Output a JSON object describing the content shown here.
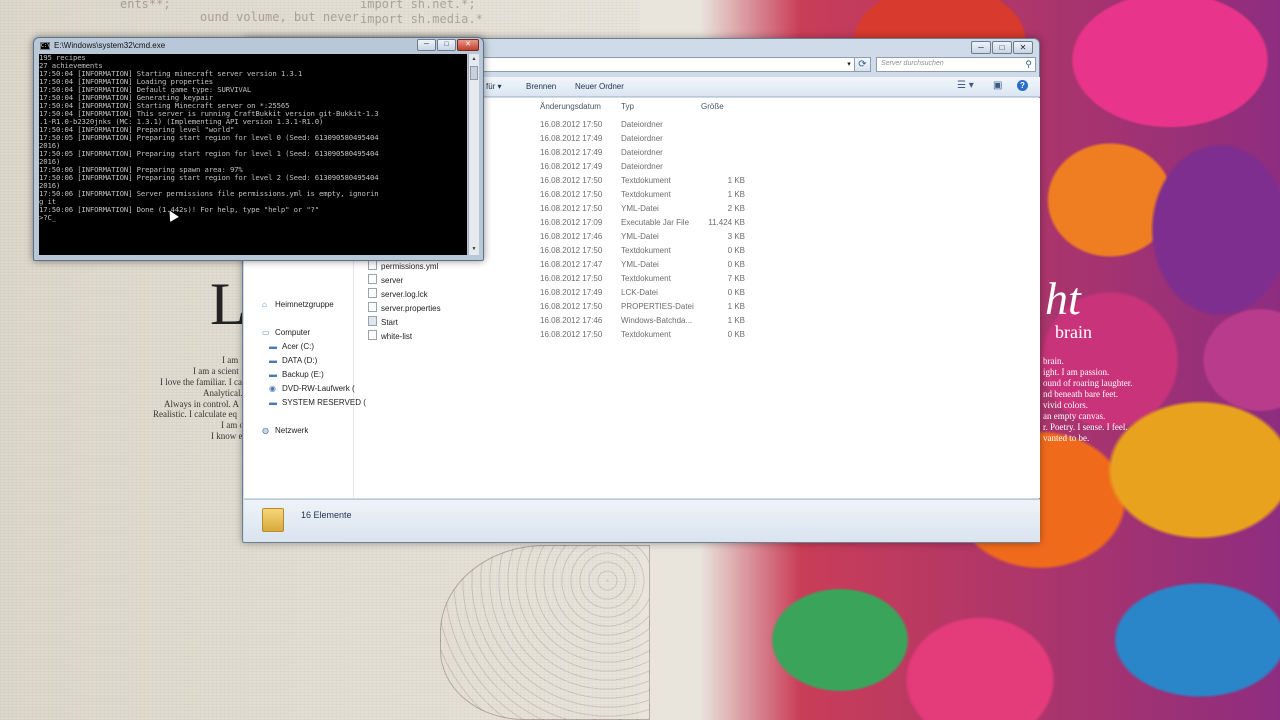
{
  "cmd": {
    "title": "E:\\Windows\\system32\\cmd.exe",
    "lines": [
      "195 recipes",
      "27 achievements",
      "17:50:04 [INFORMATION] Starting minecraft server version 1.3.1",
      "17:50:04 [INFORMATION] Loading properties",
      "17:50:04 [INFORMATION] Default game type: SURVIVAL",
      "17:50:04 [INFORMATION] Generating keypair",
      "17:50:04 [INFORMATION] Starting Minecraft server on *:25565",
      "17:50:04 [INFORMATION] This server is running CraftBukkit version git-Bukkit-1.3",
      ".1-R1.0-b2320jnks (MC: 1.3.1) (Implementing API version 1.3.1-R1.0)",
      "17:50:04 [INFORMATION] Preparing level \"world\"",
      "17:50:05 [INFORMATION] Preparing start region for level 0 (Seed: 613090580495404",
      "2016)",
      "17:50:05 [INFORMATION] Preparing start region for level 1 (Seed: 613090580495404",
      "2016)",
      "17:50:06 [INFORMATION] Preparing spawn area: 97%",
      "17:50:06 [INFORMATION] Preparing start region for level 2 (Seed: 613090580495404",
      "2016)",
      "17:50:06 [INFORMATION] Server permissions file permissions.yml is empty, ignorin",
      "g it",
      "17:50:06 [INFORMATION] Done (1.442s)! For help, type \"help\" or \"?\"",
      ">?C_"
    ]
  },
  "explorer": {
    "caption": {
      "minimize": "─",
      "maximize": "□",
      "close": "✕"
    },
    "search_placeholder": "Server durchsuchen",
    "toolbar": {
      "share_label": "für ▾",
      "burn_label": "Brennen",
      "new_folder_label": "Neuer Ordner"
    },
    "columns": {
      "date": "Änderungsdatum",
      "type": "Typ",
      "size": "Größe"
    },
    "nav": [
      {
        "label": "Heimnetzgruppe",
        "icon": "homegroup-icon",
        "indent": 0
      },
      {
        "label": "Computer",
        "icon": "computer-icon",
        "indent": 0
      },
      {
        "label": "Acer (C:)",
        "icon": "drive-icon",
        "indent": 1
      },
      {
        "label": "DATA (D:)",
        "icon": "drive-icon",
        "indent": 1
      },
      {
        "label": "Backup (E:)",
        "icon": "drive-icon",
        "indent": 1
      },
      {
        "label": "DVD-RW-Laufwerk (",
        "icon": "dvd-drive-icon",
        "indent": 1
      },
      {
        "label": "SYSTEM RESERVED (",
        "icon": "drive-icon",
        "indent": 1
      },
      {
        "label": "Netzwerk",
        "icon": "network-icon",
        "indent": 0
      }
    ],
    "files": [
      {
        "name": "",
        "date": "16.08.2012 17:50",
        "type": "Dateiordner",
        "size": ""
      },
      {
        "name": "",
        "date": "16.08.2012 17:49",
        "type": "Dateiordner",
        "size": ""
      },
      {
        "name": "",
        "date": "16.08.2012 17:49",
        "type": "Dateiordner",
        "size": ""
      },
      {
        "name": "",
        "date": "16.08.2012 17:49",
        "type": "Dateiordner",
        "size": ""
      },
      {
        "name": "",
        "date": "16.08.2012 17:50",
        "type": "Textdokument",
        "size": "1 KB"
      },
      {
        "name": "",
        "date": "16.08.2012 17:50",
        "type": "Textdokument",
        "size": "1 KB"
      },
      {
        "name": "",
        "date": "16.08.2012 17:50",
        "type": "YML-Datei",
        "size": "2 KB"
      },
      {
        "name": "",
        "date": "16.08.2012 17:09",
        "type": "Executable Jar File",
        "size": "11.424 KB"
      },
      {
        "name": "",
        "date": "16.08.2012 17:46",
        "type": "YML-Datei",
        "size": "3 KB"
      },
      {
        "name": "",
        "date": "16.08.2012 17:50",
        "type": "Textdokument",
        "size": "0 KB"
      },
      {
        "name": "permissions.yml",
        "date": "16.08.2012 17:47",
        "type": "YML-Datei",
        "size": "0 KB"
      },
      {
        "name": "server",
        "date": "16.08.2012 17:50",
        "type": "Textdokument",
        "size": "7 KB"
      },
      {
        "name": "server.log.lck",
        "date": "16.08.2012 17:49",
        "type": "LCK-Datei",
        "size": "0 KB"
      },
      {
        "name": "server.properties",
        "date": "16.08.2012 17:50",
        "type": "PROPERTIES-Datei",
        "size": "1 KB"
      },
      {
        "name": "Start",
        "date": "16.08.2012 17:46",
        "type": "Windows-Batchda...",
        "size": "1 KB"
      },
      {
        "name": "white-list",
        "date": "16.08.2012 17:50",
        "type": "Textdokument",
        "size": "0 KB"
      }
    ],
    "status": "16 Elemente"
  },
  "wallpaper": {
    "big_letter": "L",
    "right_word_fragment": "ht",
    "brain_word": "brain",
    "left_lines": [
      "I am",
      "I am a scient",
      "I love the familiar. I ca",
      "Analytical. St",
      "Always in control. A",
      "Realistic. I calculate eq",
      "I am o",
      "I know e"
    ],
    "right_lines": [
      "brain.",
      "ight. I am passion.",
      "ound of roaring laughter.",
      "nd beneath bare feet.",
      "vivid colors.",
      "an empty canvas.",
      "r. Poetry. I sense. I feel.",
      "vanted to be."
    ],
    "code_lines": [
      "ents**;",
      "ound volume, but never",
      "import sh.net.*;",
      "import sh.media.*"
    ]
  }
}
